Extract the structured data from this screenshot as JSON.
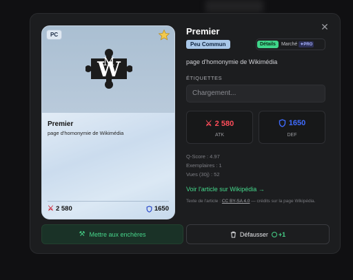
{
  "card": {
    "platform": "PC",
    "title": "Premier",
    "subtitle": "page d'homonymie de Wikimédia",
    "atk": "2 580",
    "def": "1650"
  },
  "detail": {
    "title": "Premier",
    "rarity": "Peu Commun",
    "tabs": {
      "details": "Détails",
      "market": "Marché",
      "pro": "PRO"
    },
    "description": "page d'homonymie de Wikimédia",
    "tags_label": "ÉTIQUETTES",
    "tags_placeholder": "Chargement...",
    "atk_value": "2 580",
    "atk_label": "ATK",
    "def_value": "1650",
    "def_label": "DEF",
    "q_score": "Q-Score : 4.97",
    "copies": "Exemplaires : 1",
    "views": "Vues (30j) : 52",
    "wiki_link": "Voir l'article sur Wikipédia →",
    "license_prefix": "Texte de l'article : ",
    "license_name": "CC BY-SA 4.0",
    "license_suffix": " — crédits sur la page Wikipédia."
  },
  "actions": {
    "auction": "Mettre aux enchères",
    "defuse": "Défausser",
    "defuse_reward": "+1"
  },
  "colors": {
    "accent_green": "#45d98c",
    "atk_red": "#ff4d5a",
    "def_blue": "#3f6bff",
    "rarity_bg": "#a9c7e8"
  }
}
